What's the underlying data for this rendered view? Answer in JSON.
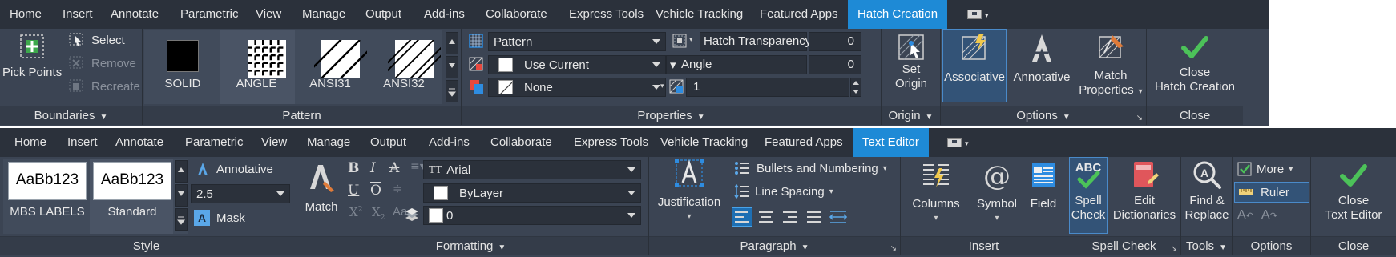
{
  "top": {
    "tabs": [
      "Home",
      "Insert",
      "Annotate",
      "Parametric",
      "View",
      "Manage",
      "Output",
      "Add-ins",
      "Collaborate",
      "Express Tools",
      "Vehicle Tracking",
      "Featured Apps"
    ],
    "active_tab": "Hatch Creation",
    "boundaries": {
      "pick_points": "Pick Points",
      "select": "Select",
      "remove": "Remove",
      "recreate": "Recreate",
      "title": "Boundaries"
    },
    "pattern": {
      "items": [
        "SOLID",
        "ANGLE",
        "ANSI31",
        "ANSI32"
      ],
      "title": "Pattern"
    },
    "properties": {
      "pattern_type": "Pattern",
      "color": "Use Current",
      "background": "None",
      "transparency_label": "Hatch Transparency",
      "transparency_value": "0",
      "angle_label": "Angle",
      "angle_value": "0",
      "scale_value": "1",
      "title": "Properties"
    },
    "origin": {
      "set_origin_line1": "Set",
      "set_origin_line2": "Origin",
      "title": "Origin"
    },
    "options": {
      "associative": "Associative",
      "annotative": "Annotative",
      "match_line1": "Match",
      "match_line2": "Properties",
      "title": "Options"
    },
    "close": {
      "line1": "Close",
      "line2": "Hatch Creation",
      "title": "Close"
    }
  },
  "bottom": {
    "tabs": [
      "Home",
      "Insert",
      "Annotate",
      "Parametric",
      "View",
      "Manage",
      "Output",
      "Add-ins",
      "Collaborate",
      "Express Tools",
      "Vehicle Tracking",
      "Featured Apps"
    ],
    "active_tab": "Text Editor",
    "style": {
      "card1_sample": "AaBb123",
      "card1_name": "MBS LABELS",
      "card2_sample": "AaBb123",
      "card2_name": "Standard",
      "annotative": "Annotative",
      "height_value": "2.5",
      "mask": "Mask",
      "title": "Style"
    },
    "formatting": {
      "match": "Match",
      "bold": "B",
      "italic": "I",
      "strike": "A",
      "underline": "U",
      "overline": "O",
      "superscript": "X",
      "subscript": "X",
      "case": "Aa",
      "font": "Arial",
      "color": "ByLayer",
      "oblique": "0",
      "title": "Formatting"
    },
    "paragraph": {
      "justification": "Justification",
      "bullets": "Bullets and Numbering",
      "line_spacing": "Line Spacing",
      "title": "Paragraph"
    },
    "insert": {
      "columns": "Columns",
      "symbol": "Symbol",
      "field": "Field",
      "title": "Insert"
    },
    "spell": {
      "spell_line1": "Spell",
      "spell_line2": "Check",
      "edit_line1": "Edit",
      "edit_line2": "Dictionaries",
      "title": "Spell Check"
    },
    "tools": {
      "find_line1": "Find &",
      "find_line2": "Replace",
      "title": "Tools"
    },
    "options": {
      "more": "More",
      "ruler": "Ruler",
      "title": "Options"
    },
    "close": {
      "line1": "Close",
      "line2": "Text Editor",
      "title": "Close"
    }
  },
  "colors": {
    "ribbon_bg": "#3b4453",
    "tabbar_bg": "#2b313b",
    "active_tab": "#1e8ad6",
    "accent_green": "#4cc259",
    "highlight": "#335377"
  }
}
